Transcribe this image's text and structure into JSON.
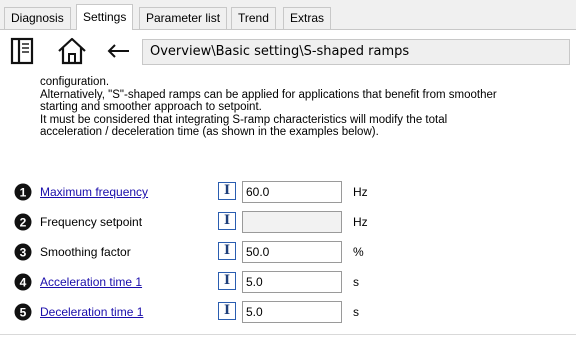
{
  "tabs": [
    {
      "label": "Diagnosis",
      "active": false
    },
    {
      "label": "Settings",
      "active": true
    },
    {
      "label": "Parameter list",
      "active": false
    },
    {
      "label": "Trend",
      "active": false
    },
    {
      "label": "Extras",
      "active": false
    }
  ],
  "toolbar": {
    "icons": [
      "panel-icon",
      "home-icon",
      "back-arrow-icon"
    ],
    "path": "Overview\\Basic setting\\S-shaped ramps"
  },
  "description": [
    "configuration.",
    "Alternatively, \"S\"-shaped ramps can be applied for applications that benefit from smoother",
    "starting and smoother approach to setpoint.",
    "It must be considered that integrating S-ramp characteristics will modify the total",
    "acceleration / deceleration time (as shown in the examples below)."
  ],
  "params": [
    {
      "num": "1",
      "label": "Maximum frequency",
      "link": true,
      "input_icon": "I",
      "value": "60.0",
      "unit": "Hz"
    },
    {
      "num": "2",
      "label": "Frequency setpoint",
      "link": false,
      "input_icon": "I",
      "value": "",
      "unit": "Hz"
    },
    {
      "num": "3",
      "label": "Smoothing factor",
      "link": false,
      "input_icon": "I",
      "value": "50.0",
      "unit": "%"
    },
    {
      "num": "4",
      "label": "Acceleration time 1",
      "link": true,
      "input_icon": "I",
      "value": "5.0",
      "unit": "s"
    },
    {
      "num": "5",
      "label": "Deceleration time 1",
      "link": true,
      "input_icon": "I",
      "value": "5.0",
      "unit": "s"
    }
  ],
  "colors": {
    "link": "#1a0dab",
    "input_icon_border": "#2a5db0",
    "tab_bg": "#f0f0f0"
  }
}
